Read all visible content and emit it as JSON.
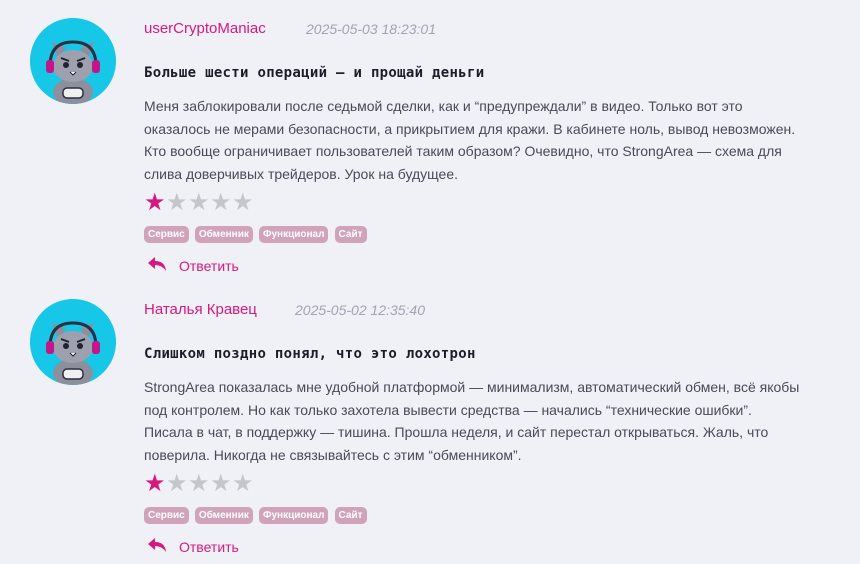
{
  "reviews": [
    {
      "author": "userCryptoManiac",
      "date": "2025-05-03 18:23:01",
      "title": "Больше шести операций — и прощай деньги",
      "text": "Меня заблокировали после седьмой сделки, как и “предупреждали” в видео. Только вот это оказалось не мерами безопасности, а прикрытием для кражи. В кабинете ноль, вывод невозможен. Кто вообще ограничивает пользователей таким образом? Очевидно, что StrongArea — схема для слива доверчивых трейдеров. Урок на будущее.",
      "rating": 1,
      "rating_max": 5,
      "tags": [
        "Сервис",
        "Обменник",
        "Функционал",
        "Сайт"
      ],
      "reply_label": "Ответить"
    },
    {
      "author": "Наталья Кравец",
      "date": "2025-05-02 12:35:40",
      "title": "Слишком поздно понял, что это лохотрон",
      "text": "StrongArea показалась мне удобной платформой — минимализм, автоматический обмен, всё якобы под контролем. Но как только захотела вывести средства — начались “технические ошибки”. Писала в чат, в поддержку — тишина. Прошла неделя, и сайт перестал открываться. Жаль, что поверила. Никогда не связывайтесь с этим “обменником”.",
      "rating": 1,
      "rating_max": 5,
      "tags": [
        "Сервис",
        "Обменник",
        "Функционал",
        "Сайт"
      ],
      "reply_label": "Ответить"
    }
  ],
  "colors": {
    "accent": "#d6197e",
    "star_off": "#c5c5cc",
    "tag_bg": "#d1a3bb",
    "avatar_bg": "#17c7e8"
  }
}
